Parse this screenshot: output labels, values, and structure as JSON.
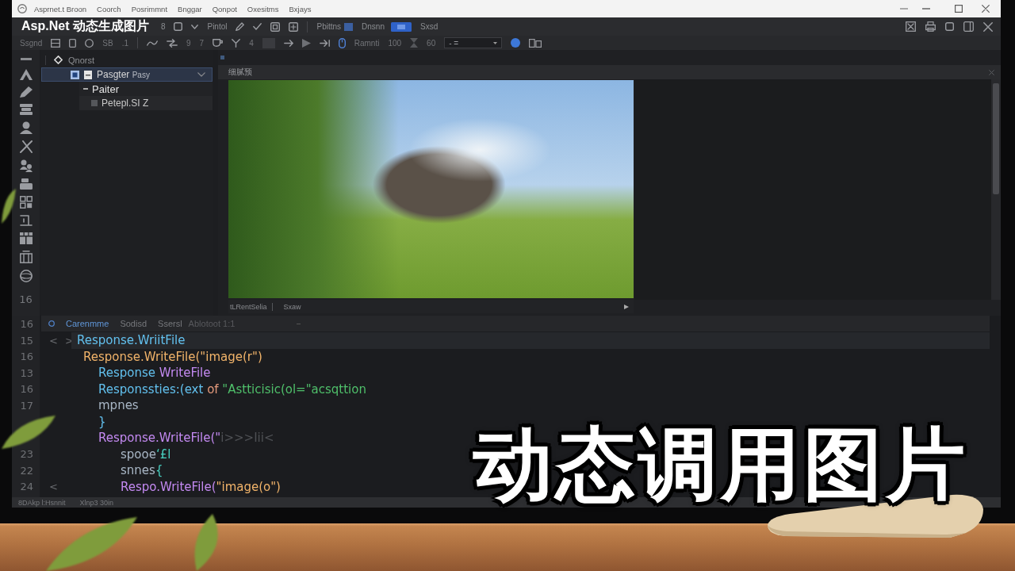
{
  "menu_bar": {
    "items": [
      "Asprnet.t Broon",
      "Coorch",
      "Posrimmnt",
      "Bnggar",
      "Qonpot",
      "Oxesitms",
      "Bxjays"
    ]
  },
  "toolbar": {
    "title": "Asp.Net 动态生成图片",
    "row_1": [
      {
        "kind": "label",
        "text": "8"
      },
      {
        "kind": "label",
        "text": "Pintol"
      },
      {
        "kind": "swatch",
        "text": "Pbittns"
      },
      {
        "kind": "select",
        "text": "Dnsnn"
      },
      {
        "kind": "label",
        "text": "Sxsd"
      }
    ],
    "row_2": [
      {
        "kind": "label",
        "text": "Ssgnd"
      },
      {
        "kind": "label",
        "text": "SB"
      },
      {
        "kind": "label",
        "text": ".1"
      },
      {
        "kind": "label",
        "text": "9"
      },
      {
        "kind": "label",
        "text": "7"
      },
      {
        "kind": "label",
        "text": "4"
      },
      {
        "kind": "label",
        "text": "Ramnti"
      },
      {
        "kind": "label",
        "text": "100"
      },
      {
        "kind": "label",
        "text": "60"
      },
      {
        "kind": "dropdown",
        "text": "- ="
      }
    ]
  },
  "activity_bar": {
    "number": "16"
  },
  "tree": {
    "header": "Qnorst",
    "items": [
      {
        "label": "Pasgter",
        "detail": "Pasy",
        "selected": true,
        "checked": true,
        "expanded": true,
        "children": [
          {
            "label": "Paiter",
            "kind": "folder",
            "selected": false
          },
          {
            "label": "Petepl.SI Z",
            "kind": "file",
            "selected": false
          }
        ]
      }
    ]
  },
  "preview": {
    "header": "细腻预",
    "footer": [
      "tLRentSelia",
      "Sxaw"
    ]
  },
  "code": {
    "tab_row_number": "16",
    "tabs": [
      {
        "label": "Carenmme",
        "selected": true
      },
      {
        "label": "Sodisd",
        "selected": false
      },
      {
        "label": "Ssersl",
        "selected": false
      }
    ],
    "position": "Ablotoot 1:1",
    "lines": [
      {
        "number": "15",
        "current": true,
        "fold": [
          "<",
          ">"
        ],
        "segments": [
          {
            "kind": "type",
            "text": "Response.WriitFile"
          }
        ]
      },
      {
        "number": "16",
        "current": false,
        "segments": [
          {
            "kind": "call",
            "text": "Response.WriteFile(\"image(r\")"
          }
        ]
      },
      {
        "number": "13",
        "current": false,
        "segments": [
          {
            "kind": "type",
            "text": "Response"
          },
          {
            "kind": "method",
            "text": " WriteFile"
          }
        ]
      },
      {
        "number": "16",
        "current": false,
        "segments": [
          {
            "kind": "type",
            "text": "Responssties:(ext "
          },
          {
            "kind": "keyword",
            "text": "of "
          },
          {
            "kind": "string",
            "text": "\"Astticisic(ol=\"acsqttion"
          }
        ]
      },
      {
        "number": "17",
        "current": false,
        "segments": [
          {
            "kind": "plain",
            "text": "mpnes"
          }
        ]
      },
      {
        "current": false,
        "segments": [
          {
            "kind": "type",
            "text": "}"
          }
        ]
      },
      {
        "current": false,
        "segments": [
          {
            "kind": "method",
            "text": "Response.WriteFile(\""
          },
          {
            "kind": "faint",
            "text": "i>>>Iii<"
          }
        ]
      },
      {
        "number": "23",
        "current": false,
        "segments": [
          {
            "kind": "plain",
            "text": "spooe"
          },
          {
            "kind": "punct",
            "text": "‘£l"
          }
        ]
      },
      {
        "number": "22",
        "current": false,
        "segments": [
          {
            "kind": "plain",
            "text": "snnes"
          },
          {
            "kind": "punct",
            "text": "{"
          }
        ]
      },
      {
        "number": "24",
        "current": false,
        "fold": [
          "<"
        ],
        "segments": [
          {
            "kind": "method",
            "text": "Respo.WriteFile("
          },
          {
            "kind": "call",
            "text": "\"image(o\")"
          }
        ]
      }
    ]
  },
  "status_bar": [
    "8DAkp l:Hsnnit",
    "Xlnp3 30in"
  ],
  "headline": "动态调用图片"
}
